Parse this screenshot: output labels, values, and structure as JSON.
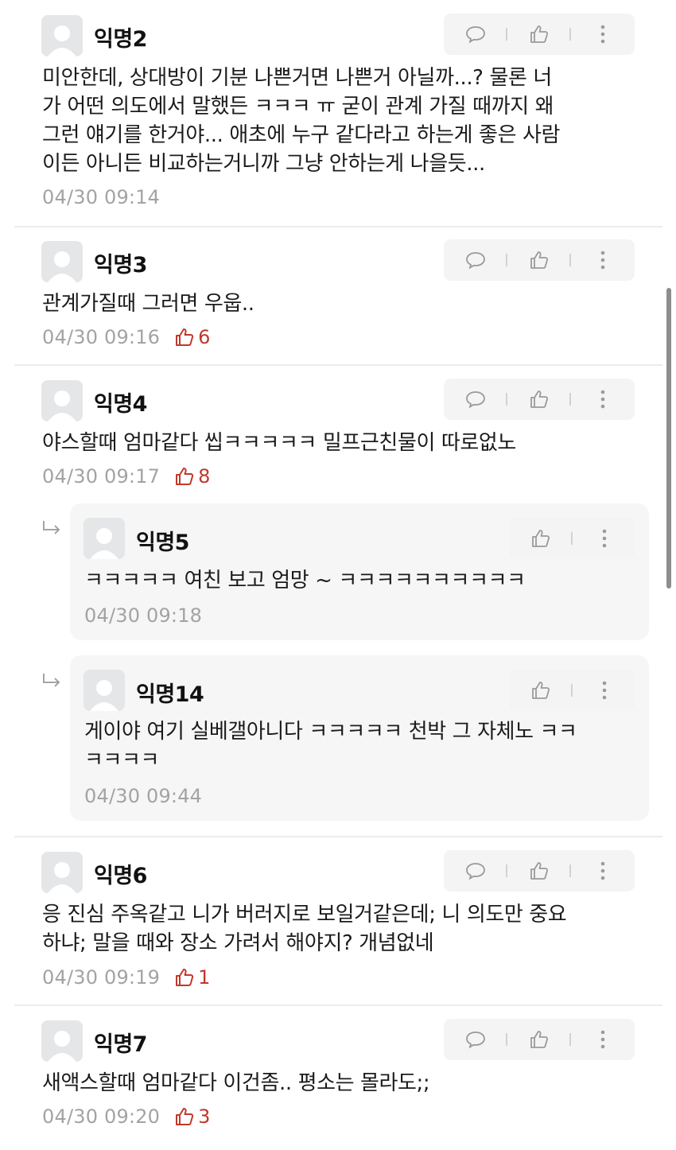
{
  "comments": [
    {
      "author": "익명2",
      "lines": [
        "미안한데, 상대방이 기분 나쁜거면 나쁜거 아닐까...?  물론 너",
        "가 어떤 의도에서 말했든 ㅋㅋㅋ ㅠ 굳이 관계 가질 때까지 왜",
        "그런 얘기를 한거야... 애초에 누구 같다라고 하는게 좋은 사람",
        "이든 아니든 비교하는거니까 그냥 안하는게 나을듯..."
      ],
      "time": "04/30 09:14",
      "likes": ""
    },
    {
      "author": "익명3",
      "lines": [
        "관계가질때 그러면 우웁.."
      ],
      "time": "04/30 09:16",
      "likes": "6"
    },
    {
      "author": "익명4",
      "lines": [
        "야스할때 엄마같다 씹ㅋㅋㅋㅋㅋ 밀프근친물이 따로없노"
      ],
      "time": "04/30 09:17",
      "likes": "8"
    },
    {
      "author": "익명6",
      "lines": [
        "응 진심 주옥같고 니가 버러지로 보일거같은데; 니 의도만 중요",
        "하냐; 말을 때와 장소 가려서 해야지? 개념없네"
      ],
      "time": "04/30 09:19",
      "likes": "1"
    },
    {
      "author": "익명7",
      "lines": [
        "새액스할때 엄마같다 이건좀.. 평소는 몰라도;;"
      ],
      "time": "04/30 09:20",
      "likes": "3"
    }
  ],
  "replies": [
    {
      "author": "익명5",
      "lines": [
        "ㅋㅋㅋㅋㅋ 여친 보고 엄망 ~ ㅋㅋㅋㅋㅋㅋㅋㅋㅋㅋ"
      ],
      "time": "04/30 09:18"
    },
    {
      "author": "익명14",
      "lines": [
        "게이야 여기 실베갤아니다 ㅋㅋㅋㅋㅋ 천박 그 자체노 ㅋㅋ",
        "ㅋㅋㅋㅋ"
      ],
      "time": "04/30 09:44"
    }
  ],
  "icons": {
    "comment": "speech-bubble-icon",
    "like": "thumbs-up-icon",
    "more": "vertical-dots-icon",
    "reply": "reply-arrow-icon"
  },
  "colors": {
    "like_count": "#c0392b",
    "meta": "#a3a3a3",
    "action_bg": "#f4f4f4",
    "reply_bg": "#f6f6f6"
  }
}
